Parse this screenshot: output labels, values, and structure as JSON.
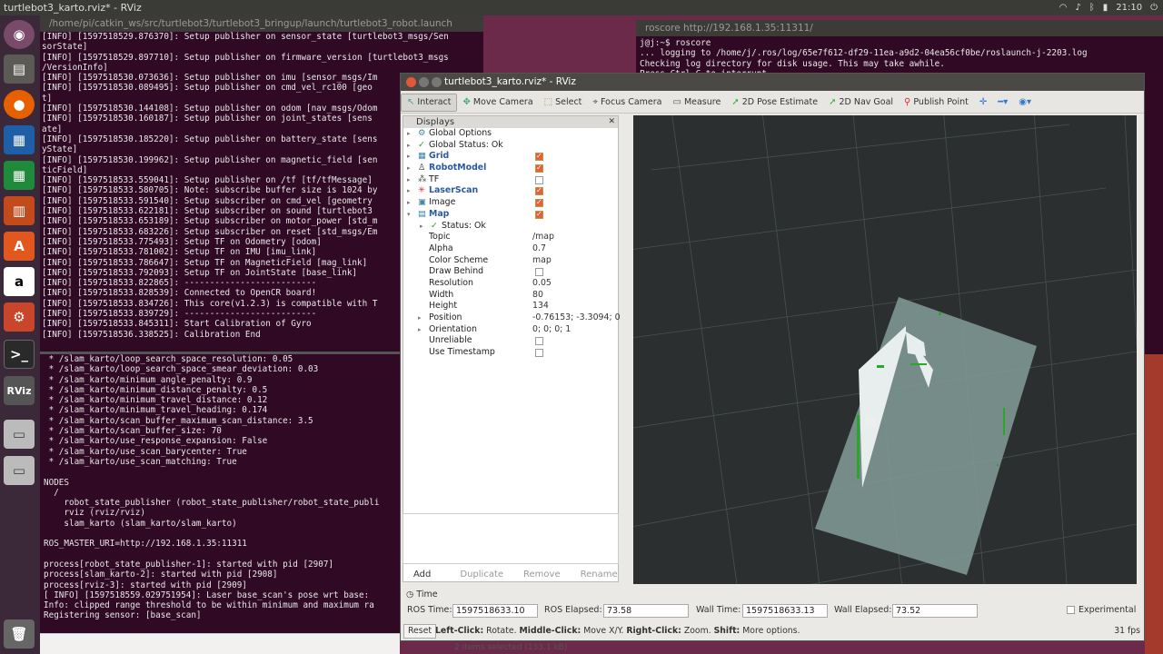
{
  "topbar": {
    "title": "turtlebot3_karto.rviz* - RViz",
    "clock": "21:10"
  },
  "left_terminal": {
    "title": "/home/pi/catkin_ws/src/turtlebot3/turtlebot3_bringup/launch/turtlebot3_robot.launch",
    "text": "[INFO] [1597518529.876370]: Setup publisher on sensor_state [turtlebot3_msgs/Sen\nsorState]\n[INFO] [1597518529.897710]: Setup publisher on firmware_version [turtlebot3_msgs\n/VersionInfo]\n[INFO] [1597518530.073636]: Setup publisher on imu [sensor_msgs/Im\n[INFO] [1597518530.089495]: Setup publisher on cmd_vel_rc100 [geo\nt]\n[INFO] [1597518530.144108]: Setup publisher on odom [nav_msgs/Odom\n[INFO] [1597518530.160187]: Setup publisher on joint_states [sens\nate]\n[INFO] [1597518530.185220]: Setup publisher on battery_state [sens\nyState]\n[INFO] [1597518530.199962]: Setup publisher on magnetic_field [sen\nticField]\n[INFO] [1597518533.559041]: Setup publisher on /tf [tf/tfMessage]\n[INFO] [1597518533.580705]: Note: subscribe buffer size is 1024 by\n[INFO] [1597518533.591540]: Setup subscriber on cmd_vel [geometry\n[INFO] [1597518533.622181]: Setup subscriber on sound [turtlebot3\n[INFO] [1597518533.653189]: Setup subscriber on motor_power [std_m\n[INFO] [1597518533.683226]: Setup subscriber on reset [std_msgs/Em\n[INFO] [1597518533.775493]: Setup TF on Odometry [odom]\n[INFO] [1597518533.781002]: Setup TF on IMU [imu_link]\n[INFO] [1597518533.786647]: Setup TF on MagneticField [mag_link]\n[INFO] [1597518533.792093]: Setup TF on JointState [base_link]\n[INFO] [1597518533.822865]: --------------------------\n[INFO] [1597518533.828539]: Connected to OpenCR board!\n[INFO] [1597518533.834726]: This core(v1.2.3) is compatible with T\n[INFO] [1597518533.839729]: --------------------------\n[INFO] [1597518533.845311]: Start Calibration of Gyro\n[INFO] [1597518536.338525]: Calibration End"
  },
  "bottom_terminal": {
    "text": " * /slam_karto/loop_search_space_resolution: 0.05\n * /slam_karto/loop_search_space_smear_deviation: 0.03\n * /slam_karto/minimum_angle_penalty: 0.9\n * /slam_karto/minimum_distance_penalty: 0.5\n * /slam_karto/minimum_travel_distance: 0.12\n * /slam_karto/minimum_travel_heading: 0.174\n * /slam_karto/scan_buffer_maximum_scan_distance: 3.5\n * /slam_karto/scan_buffer_size: 70\n * /slam_karto/use_response_expansion: False\n * /slam_karto/use_scan_barycenter: True\n * /slam_karto/use_scan_matching: True\n\nNODES\n  /\n    robot_state_publisher (robot_state_publisher/robot_state_publi\n    rviz (rviz/rviz)\n    slam_karto (slam_karto/slam_karto)\n\nROS_MASTER_URI=http://192.168.1.35:11311\n\nprocess[robot_state_publisher-1]: started with pid [2907]\nprocess[slam_karto-2]: started with pid [2908]\nprocess[rviz-3]: started with pid [2909]\n[ INFO] [1597518559.029751954]: Laser base_scan's pose wrt base:\nInfo: clipped range threshold to be within minimum and maximum ra\nRegistering sensor: [base_scan]"
  },
  "right_terminal": {
    "title": "roscore http://192.168.1.35:11311/",
    "text": "j@j:~$ roscore\n... logging to /home/j/.ros/log/65e7f612-df29-11ea-a9d2-04ea56cf0be/roslaunch-j-2203.log\nChecking log directory for disk usage. This may take awhile.\nPress Ctrl-C to interrupt"
  },
  "nautilus_status": "2 items selected (133.1 kB)",
  "rviz": {
    "title": "turtlebot3_karto.rviz* - RViz",
    "toolbar": [
      "Interact",
      "Move Camera",
      "Select",
      "Focus Camera",
      "Measure",
      "2D Pose Estimate",
      "2D Nav Goal",
      "Publish Point"
    ],
    "displays_title": "Displays",
    "displays": [
      {
        "label": "Global Options",
        "val": ""
      },
      {
        "label": "Global Status: Ok",
        "val": ""
      },
      {
        "label": "Grid",
        "val": ""
      },
      {
        "label": "RobotModel",
        "val": ""
      },
      {
        "label": "TF",
        "val": ""
      },
      {
        "label": "LaserScan",
        "val": ""
      },
      {
        "label": "Image",
        "val": ""
      },
      {
        "label": "Map",
        "val": ""
      },
      {
        "label": "Status: Ok",
        "val": ""
      },
      {
        "label": "Topic",
        "val": "/map"
      },
      {
        "label": "Alpha",
        "val": "0.7"
      },
      {
        "label": "Color Scheme",
        "val": "map"
      },
      {
        "label": "Draw Behind",
        "val": ""
      },
      {
        "label": "Resolution",
        "val": "0.05"
      },
      {
        "label": "Width",
        "val": "80"
      },
      {
        "label": "Height",
        "val": "134"
      },
      {
        "label": "Position",
        "val": "-0.76153; -3.3094; 0"
      },
      {
        "label": "Orientation",
        "val": "0; 0; 0; 1"
      },
      {
        "label": "Unreliable",
        "val": ""
      },
      {
        "label": "Use Timestamp",
        "val": ""
      }
    ],
    "buttons": {
      "add": "Add",
      "duplicate": "Duplicate",
      "remove": "Remove",
      "rename": "Rename"
    },
    "time": {
      "panel_title": "Time",
      "ros_time_label": "ROS Time:",
      "ros_time": "1597518633.10",
      "ros_elapsed_label": "ROS Elapsed:",
      "ros_elapsed": "73.58",
      "wall_time_label": "Wall Time:",
      "wall_time": "1597518633.13",
      "wall_elapsed_label": "Wall Elapsed:",
      "wall_elapsed": "73.52",
      "experimental": "Experimental"
    },
    "status": {
      "reset": "Reset",
      "hint_left": "Left-Click:",
      "hint_left_t": "Rotate.",
      "hint_mid": "Middle-Click:",
      "hint_mid_t": "Move X/Y.",
      "hint_right": "Right-Click:",
      "hint_right_t": "Zoom.",
      "hint_shift": "Shift:",
      "hint_shift_t": "More options.",
      "fps": "31 fps"
    }
  },
  "colors": {
    "terminal_bg": "#300a24",
    "desktop": "#6b2a4a",
    "accent": "#e8603a"
  }
}
